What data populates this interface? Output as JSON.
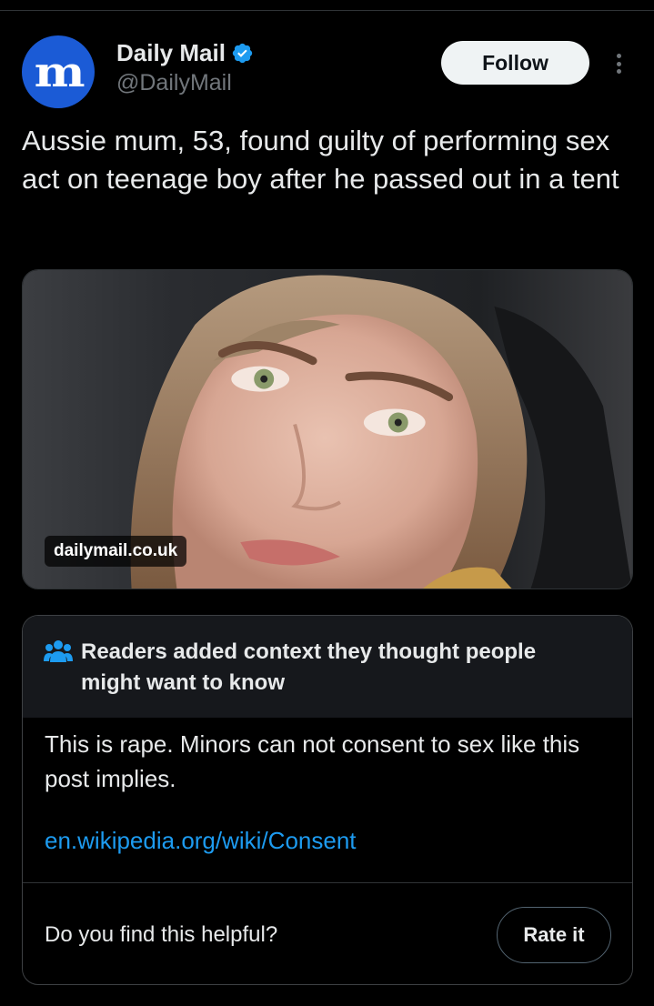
{
  "account": {
    "avatar_text": "m",
    "name": "Daily Mail",
    "handle": "@DailyMail",
    "verified_icon": "verified-badge-icon",
    "follow_label": "Follow",
    "more_icon": "more-vertical-icon"
  },
  "tweet": {
    "text": "Aussie mum, 53, found guilty of performing sex act on teenage boy after he passed out in a tent"
  },
  "media": {
    "domain_label": "dailymail.co.uk",
    "image": "portrait-photo"
  },
  "community_note": {
    "icon": "people-icon",
    "title": "Readers added context they thought people might want to know",
    "body": "This is rape. Minors can not consent to sex like this post implies.",
    "link": "en.wikipedia.org/wiki/Consent",
    "helpful_prompt": "Do you find this helpful?",
    "rate_label": "Rate it"
  },
  "colors": {
    "background": "#000000",
    "text": "#e7e9ea",
    "muted": "#71767b",
    "link": "#1d9bf0",
    "brand": "#1b5bd6"
  }
}
